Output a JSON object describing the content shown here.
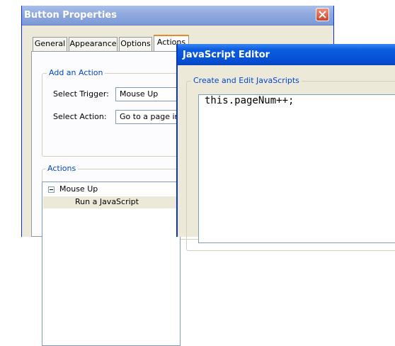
{
  "button_properties": {
    "title": "Button Properties",
    "tabs": [
      {
        "label": "General",
        "active": false
      },
      {
        "label": "Appearance",
        "active": false
      },
      {
        "label": "Options",
        "active": false
      },
      {
        "label": "Actions",
        "active": true
      }
    ],
    "add_action_group": {
      "legend": "Add an Action",
      "select_trigger_label": "Select Trigger:",
      "select_trigger_value": "Mouse Up",
      "select_action_label": "Select Action:",
      "select_action_value": "Go to a page in t"
    },
    "actions_group": {
      "legend": "Actions",
      "tree": {
        "node_label": "Mouse Up",
        "child_label": "Run a JavaScript"
      }
    }
  },
  "javascript_editor": {
    "title": "JavaScript Editor",
    "group_legend": "Create and Edit JavaScripts",
    "code": "this.pageNum++;"
  },
  "colors": {
    "xp_blue_title": "#0650d6",
    "inactive_title": "#8fa9de",
    "dialog_face": "#ece9d8",
    "group_legend_blue": "#0046d5",
    "close_red": "#d0442b"
  }
}
